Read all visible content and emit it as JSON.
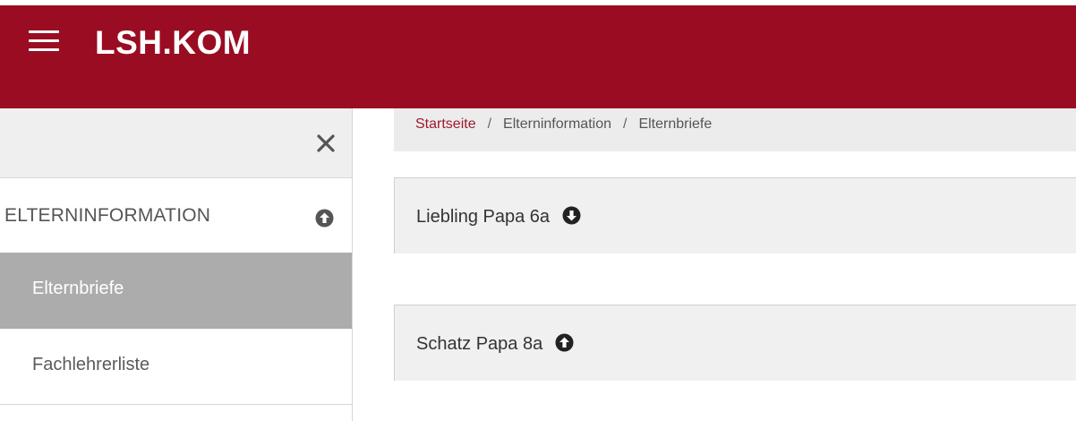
{
  "header": {
    "brand": "LSH.KOM",
    "background_color": "#9a0c22",
    "menu_icon": "hamburger-menu-icon"
  },
  "sidebar": {
    "close_icon": "close-icon",
    "section": {
      "label": "ELTERNINFORMATION",
      "toggle_icon": "circle-arrow-up-icon"
    },
    "items": [
      {
        "label": "Elternbriefe",
        "active": true
      },
      {
        "label": "Fachlehrerliste",
        "active": false
      }
    ]
  },
  "breadcrumb": {
    "items": [
      "Startseite",
      "Elterninformation",
      "Elternbriefe"
    ],
    "separator": "/",
    "link_color": "#a0192d"
  },
  "panels": [
    {
      "title": "Liebling Papa 6a",
      "toggle_icon": "circle-arrow-down-icon"
    },
    {
      "title": "Schatz Papa 8a",
      "toggle_icon": "circle-arrow-up-icon"
    }
  ]
}
